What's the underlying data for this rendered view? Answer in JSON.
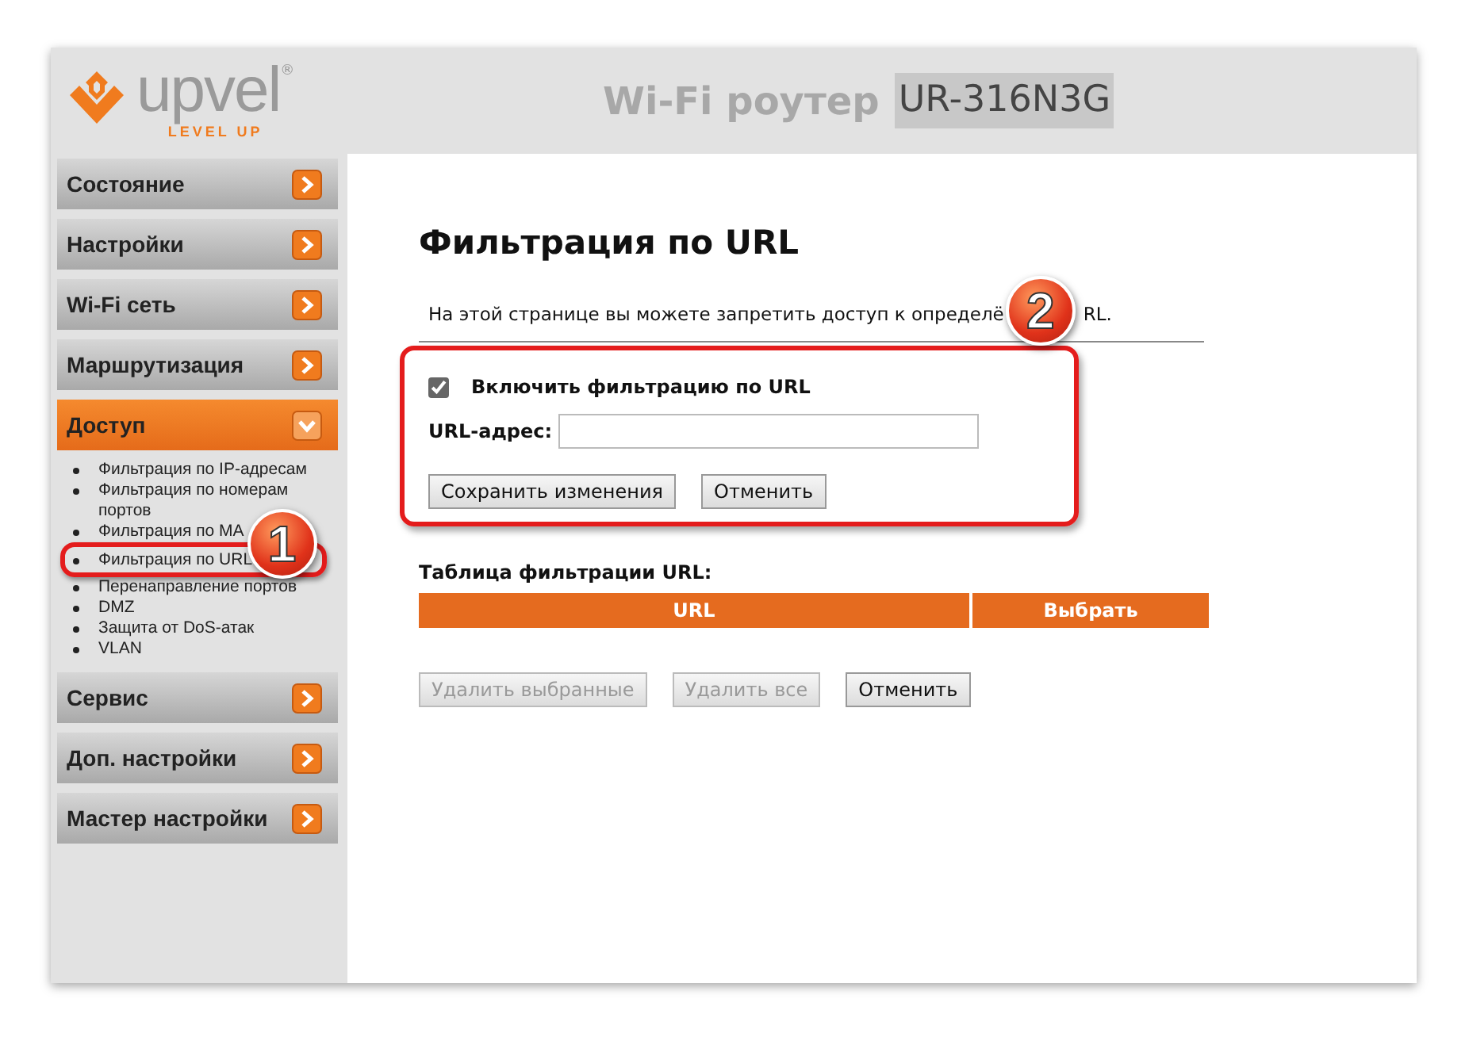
{
  "header": {
    "logo_text": "upvel",
    "logo_mark": "®",
    "logo_tagline": "LEVEL UP",
    "title": "Wi-Fi роутер",
    "model": "UR-316N3G"
  },
  "sidebar": {
    "items": [
      {
        "label": "Состояние",
        "expanded": false
      },
      {
        "label": "Настройки",
        "expanded": false
      },
      {
        "label": "Wi-Fi сеть",
        "expanded": false
      },
      {
        "label": "Маршрутизация",
        "expanded": false
      },
      {
        "label": "Доступ",
        "expanded": true,
        "children": [
          {
            "label": "Фильтрация по IP-адресам",
            "selected": false
          },
          {
            "label": "Фильтрация по номерам портов",
            "selected": false
          },
          {
            "label": "Фильтрация по MA",
            "selected": false
          },
          {
            "label": "Фильтрация по URL",
            "selected": true,
            "callout": "1"
          },
          {
            "label": "Перенаправление портов",
            "selected": false
          },
          {
            "label": "DMZ",
            "selected": false
          },
          {
            "label": "Защита от DoS-атак",
            "selected": false
          },
          {
            "label": "VLAN",
            "selected": false
          }
        ]
      },
      {
        "label": "Сервис",
        "expanded": false
      },
      {
        "label": "Доп. настройки",
        "expanded": false
      },
      {
        "label": "Мастер настройки",
        "expanded": false
      }
    ]
  },
  "content": {
    "title": "Фильтрация по URL",
    "description": [
      "На этой странице вы можете запретить доступ к определё",
      "RL."
    ],
    "form": {
      "highlighted": true,
      "callout": "2",
      "enable_label": "Включить фильтрацию по URL",
      "enable_checked": true,
      "url_label": "URL-адрес:",
      "buttons": [
        {
          "label": "Сохранить изменения",
          "disabled": false
        },
        {
          "label": "Отменить",
          "disabled": false
        }
      ]
    },
    "table": {
      "title": "Таблица фильтрации URL:",
      "columns": [
        "URL",
        "Выбрать"
      ]
    },
    "buttons": [
      {
        "label": "Удалить выбранные",
        "disabled": true
      },
      {
        "label": "Удалить все",
        "disabled": true
      },
      {
        "label": "Отменить",
        "disabled": false
      }
    ]
  }
}
